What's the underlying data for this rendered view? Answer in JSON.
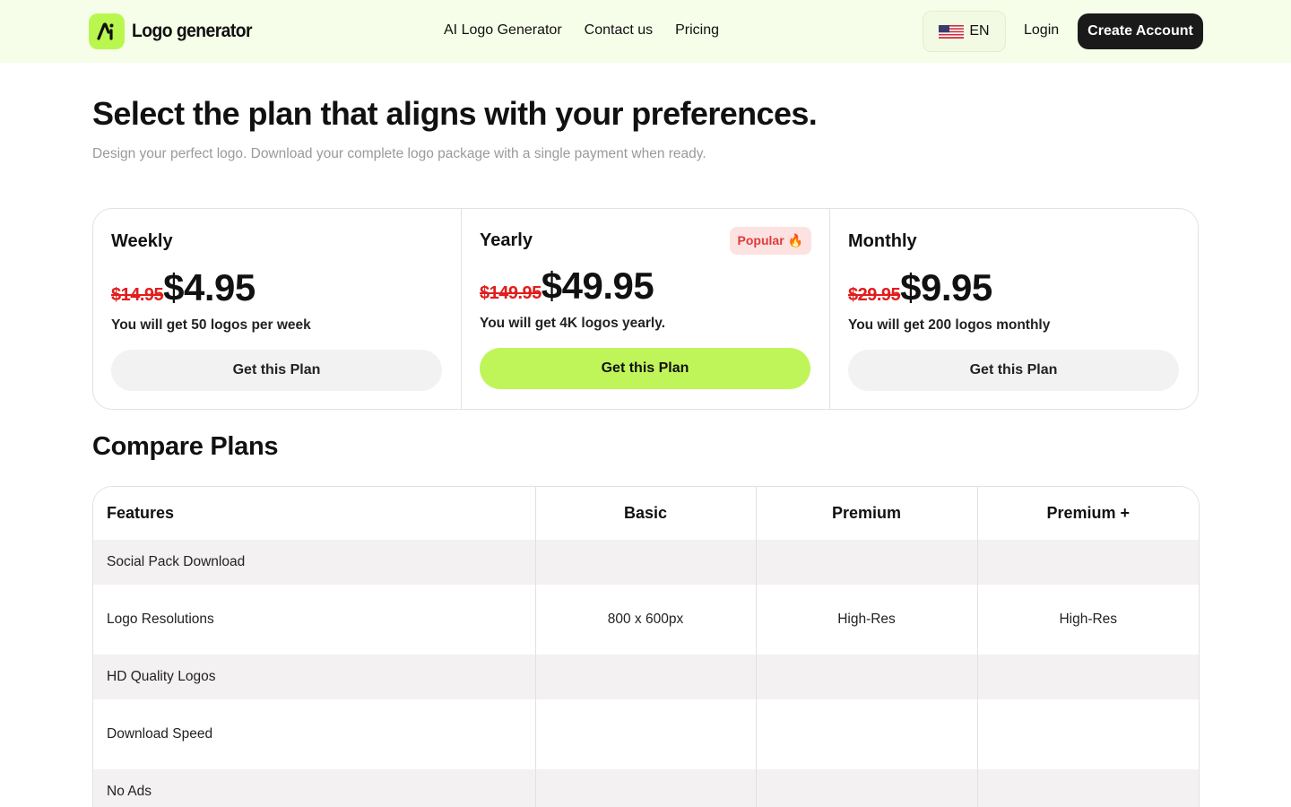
{
  "header": {
    "logo_text": "Logo generator",
    "nav": [
      "AI Logo Generator",
      "Contact us",
      "Pricing"
    ],
    "language": "EN",
    "login_label": "Login",
    "create_account_label": "Create Account"
  },
  "hero": {
    "title": "Select the plan that aligns with your preferences.",
    "subtitle": "Design your perfect logo. Download your complete logo package with a single payment when ready."
  },
  "plans": [
    {
      "name": "Weekly",
      "old_price": "$14.95",
      "price": "$4.95",
      "description": "You will get 50 logos per week",
      "button": "Get this Plan"
    },
    {
      "name": "Yearly",
      "old_price": "$149.95",
      "price": "$49.95",
      "description": "You will get 4K logos yearly.",
      "button": "Get this Plan",
      "badge": "Popular 🔥"
    },
    {
      "name": "Monthly",
      "old_price": "$29.95",
      "price": "$9.95",
      "description": "You will get 200 logos monthly",
      "button": "Get this Plan"
    }
  ],
  "compare": {
    "title": "Compare Plans",
    "columns": [
      "Features",
      "Basic",
      "Premium",
      "Premium +"
    ],
    "rows": [
      {
        "feature": "Social Pack Download",
        "values": [
          "",
          "",
          ""
        ]
      },
      {
        "feature": "Logo Resolutions",
        "values": [
          "800 x 600px",
          "High-Res",
          "High-Res"
        ]
      },
      {
        "feature": "HD Quality Logos",
        "values": [
          "",
          "",
          ""
        ]
      },
      {
        "feature": "Download Speed",
        "values": [
          "",
          "",
          ""
        ]
      },
      {
        "feature": "No Ads",
        "values": [
          "",
          "",
          ""
        ]
      }
    ]
  },
  "colors": {
    "accent": "#c0f55a",
    "header_bg": "#f6fde8",
    "strike_red": "#e11d1d",
    "dark_button": "#1a1a1a"
  },
  "icons": {
    "logo": "ai-logo-icon",
    "flag": "us-flag-icon"
  }
}
